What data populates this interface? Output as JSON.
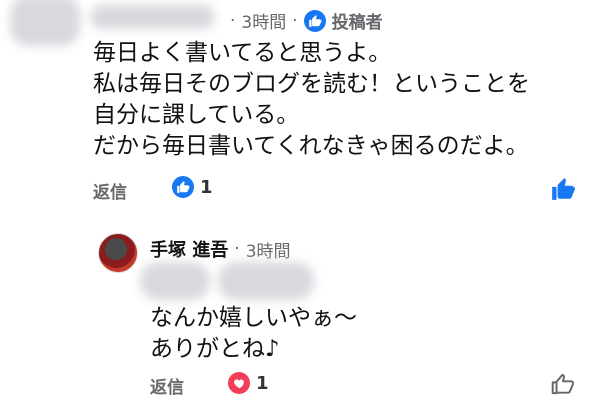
{
  "comment1": {
    "time": "3時間",
    "role": "投稿者",
    "lines": [
      "毎日よく書いてると思うよ。",
      "私は毎日そのブログを読む！ということを",
      "自分に課している。",
      "だから毎日書いてくれなきゃ困るのだよ。"
    ],
    "reply_label": "返信",
    "reaction_count": "1"
  },
  "comment2": {
    "name": "手塚 進吾",
    "time": "3時間",
    "lines": [
      "なんか嬉しいやぁ～",
      "ありがとね♪"
    ],
    "reply_label": "返信",
    "reaction_count": "1"
  },
  "colors": {
    "facebook_blue": "#1877f2",
    "love_red": "#f33e58",
    "meta_gray": "#65676b"
  }
}
